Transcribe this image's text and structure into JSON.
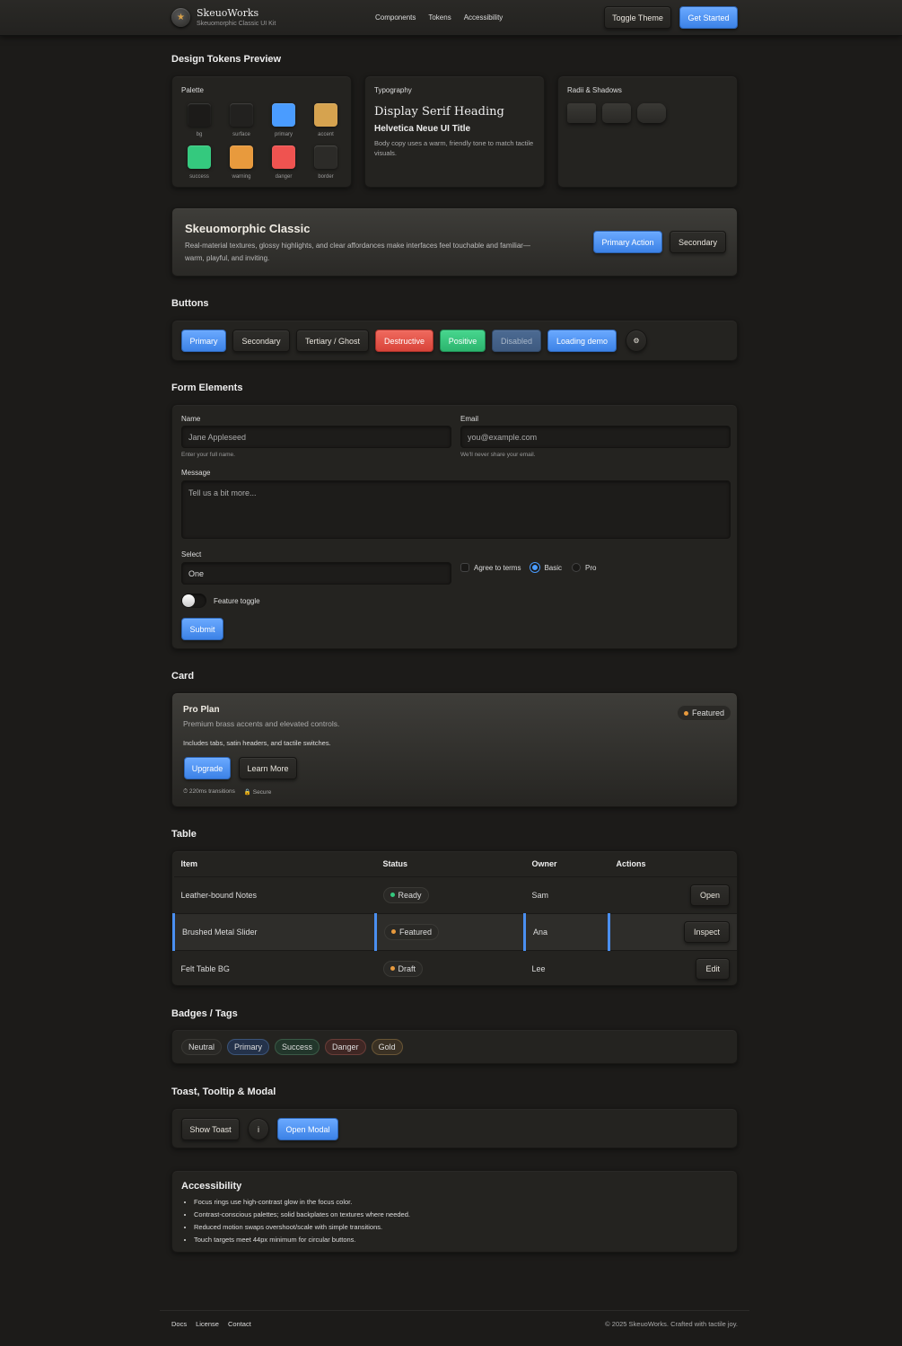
{
  "header": {
    "brand_name": "SkeuoWorks",
    "brand_sub": "Skeuomorphic Classic UI Kit",
    "logo_icon": "star-icon",
    "nav": [
      "Components",
      "Tokens",
      "Accessibility"
    ],
    "toggle_theme": "Toggle Theme",
    "get_started": "Get Started"
  },
  "tokens": {
    "title": "Design Tokens Preview",
    "palette_title": "Palette",
    "palette": [
      {
        "name": "bg",
        "color": "#1c1b19"
      },
      {
        "name": "surface",
        "color": "#22211f"
      },
      {
        "name": "primary",
        "color": "#4a9cff"
      },
      {
        "name": "accent",
        "color": "#d6a34f"
      },
      {
        "name": "success",
        "color": "#34c97e"
      },
      {
        "name": "warning",
        "color": "#e89a3d"
      },
      {
        "name": "danger",
        "color": "#ef5350"
      },
      {
        "name": "border",
        "color": "#2c2b28"
      }
    ],
    "typo_title": "Typography",
    "typo_display": "Display Serif Heading",
    "typo_ui": "Helvetica Neue UI Title",
    "typo_body": "Body copy uses a warm, friendly tone to match tactile visuals.",
    "radii_title": "Radii & Shadows"
  },
  "hero": {
    "title": "Skeuomorphic Classic",
    "text": "Real-material textures, glossy highlights, and clear affordances make interfaces feel touchable and familiar—warm, playful, and inviting.",
    "primary": "Primary Action",
    "secondary": "Secondary"
  },
  "buttons": {
    "title": "Buttons",
    "primary": "Primary",
    "secondary": "Secondary",
    "tertiary": "Tertiary / Ghost",
    "destructive": "Destructive",
    "positive": "Positive",
    "disabled": "Disabled",
    "loading": "Loading demo",
    "icon": "gear-icon"
  },
  "form": {
    "title": "Form Elements",
    "name_label": "Name",
    "name_value": "Jane Appleseed",
    "name_help": "Enter your full name.",
    "email_label": "Email",
    "email_placeholder": "you@example.com",
    "email_help": "We'll never share your email.",
    "message_label": "Message",
    "message_placeholder": "Tell us a bit more...",
    "select_label": "Select",
    "select_value": "One",
    "agree": "Agree to terms",
    "radio_basic": "Basic",
    "radio_pro": "Pro",
    "toggle": "Feature toggle",
    "submit": "Submit"
  },
  "card": {
    "title": "Card",
    "plan": "Pro Plan",
    "sub": "Premium brass accents and elevated controls.",
    "body": "Includes tabs, satin headers, and tactile switches.",
    "badge": "Featured",
    "upgrade": "Upgrade",
    "learn": "Learn More",
    "meta1": "⏱ 220ms transitions",
    "meta2": "🔒 Secure"
  },
  "table": {
    "title": "Table",
    "headers": [
      "Item",
      "Status",
      "Owner",
      "Actions"
    ],
    "rows": [
      {
        "item": "Leather-bound Notes",
        "status": "Ready",
        "status_color": "#34c97e",
        "owner": "Sam",
        "action": "Open"
      },
      {
        "item": "Brushed Metal Slider",
        "status": "Featured",
        "status_color": "#e89a3d",
        "owner": "Ana",
        "action": "Inspect"
      },
      {
        "item": "Felt Table BG",
        "status": "Draft",
        "status_color": "#e89a3d",
        "owner": "Lee",
        "action": "Edit"
      }
    ]
  },
  "badges": {
    "title": "Badges / Tags",
    "items": [
      "Neutral",
      "Primary",
      "Success",
      "Danger",
      "Gold"
    ]
  },
  "toast": {
    "title": "Toast, Tooltip & Modal",
    "show_toast": "Show Toast",
    "info": "i",
    "open_modal": "Open Modal"
  },
  "a11y": {
    "title": "Accessibility",
    "items": [
      "Focus rings use high-contrast glow in the focus color.",
      "Contrast-conscious palettes; solid backplates on textures where needed.",
      "Reduced motion swaps overshoot/scale with simple transitions.",
      "Touch targets meet 44px minimum for circular buttons."
    ]
  },
  "footer": {
    "links": [
      "Docs",
      "License",
      "Contact"
    ],
    "copyright": "© 2025 SkeuoWorks. Crafted with tactile joy."
  }
}
